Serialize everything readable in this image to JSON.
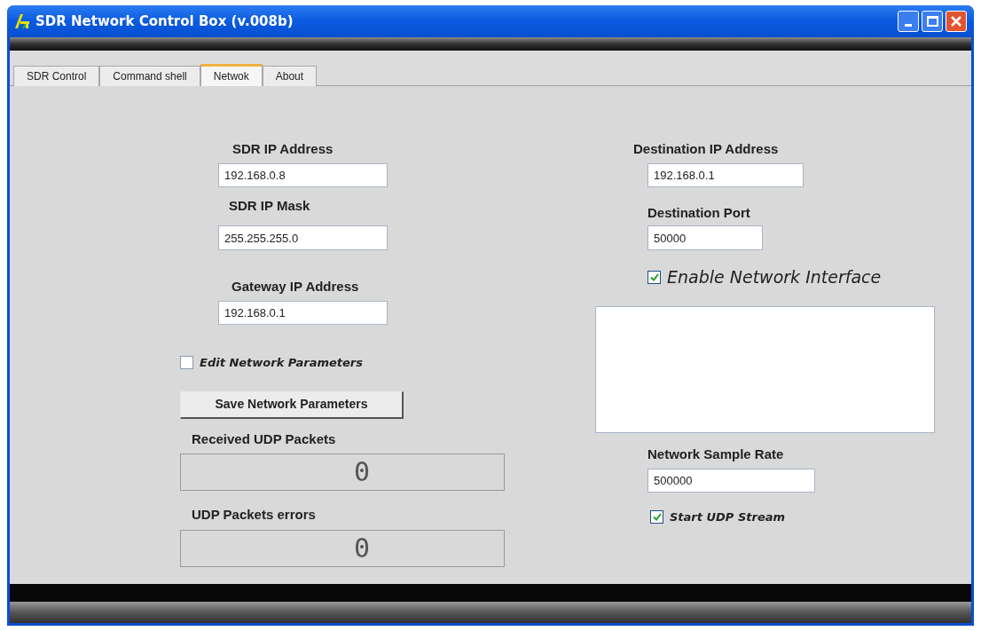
{
  "window": {
    "title": "SDR Network Control Box (v.008b)"
  },
  "tabs": [
    {
      "label": "SDR Control",
      "selected": false
    },
    {
      "label": "Command shell",
      "selected": false
    },
    {
      "label": "Netwok",
      "selected": true
    },
    {
      "label": "About",
      "selected": false
    }
  ],
  "left": {
    "sdr_ip": {
      "label": "SDR IP Address",
      "value": "192.168.0.8"
    },
    "sdr_mask": {
      "label": "SDR IP Mask",
      "value": "255.255.255.0"
    },
    "gateway": {
      "label": "Gateway IP Address",
      "value": "192.168.0.1"
    },
    "edit_params": {
      "label": "Edit Network Parameters",
      "checked": false
    },
    "save_button": "Save Network Parameters",
    "received": {
      "label": "Received UDP Packets",
      "value": "0"
    },
    "errors": {
      "label": "UDP Packets errors",
      "value": "0"
    }
  },
  "right": {
    "dest_ip": {
      "label": "Destination IP Address",
      "value": "192.168.0.1"
    },
    "dest_port": {
      "label": "Destination Port",
      "value": "50000"
    },
    "enable": {
      "label": "Enable Network Interface",
      "checked": true
    },
    "sample_rate": {
      "label": "Network Sample Rate",
      "value": "500000"
    },
    "start_stream": {
      "label": "Start UDP Stream",
      "checked": true
    }
  }
}
